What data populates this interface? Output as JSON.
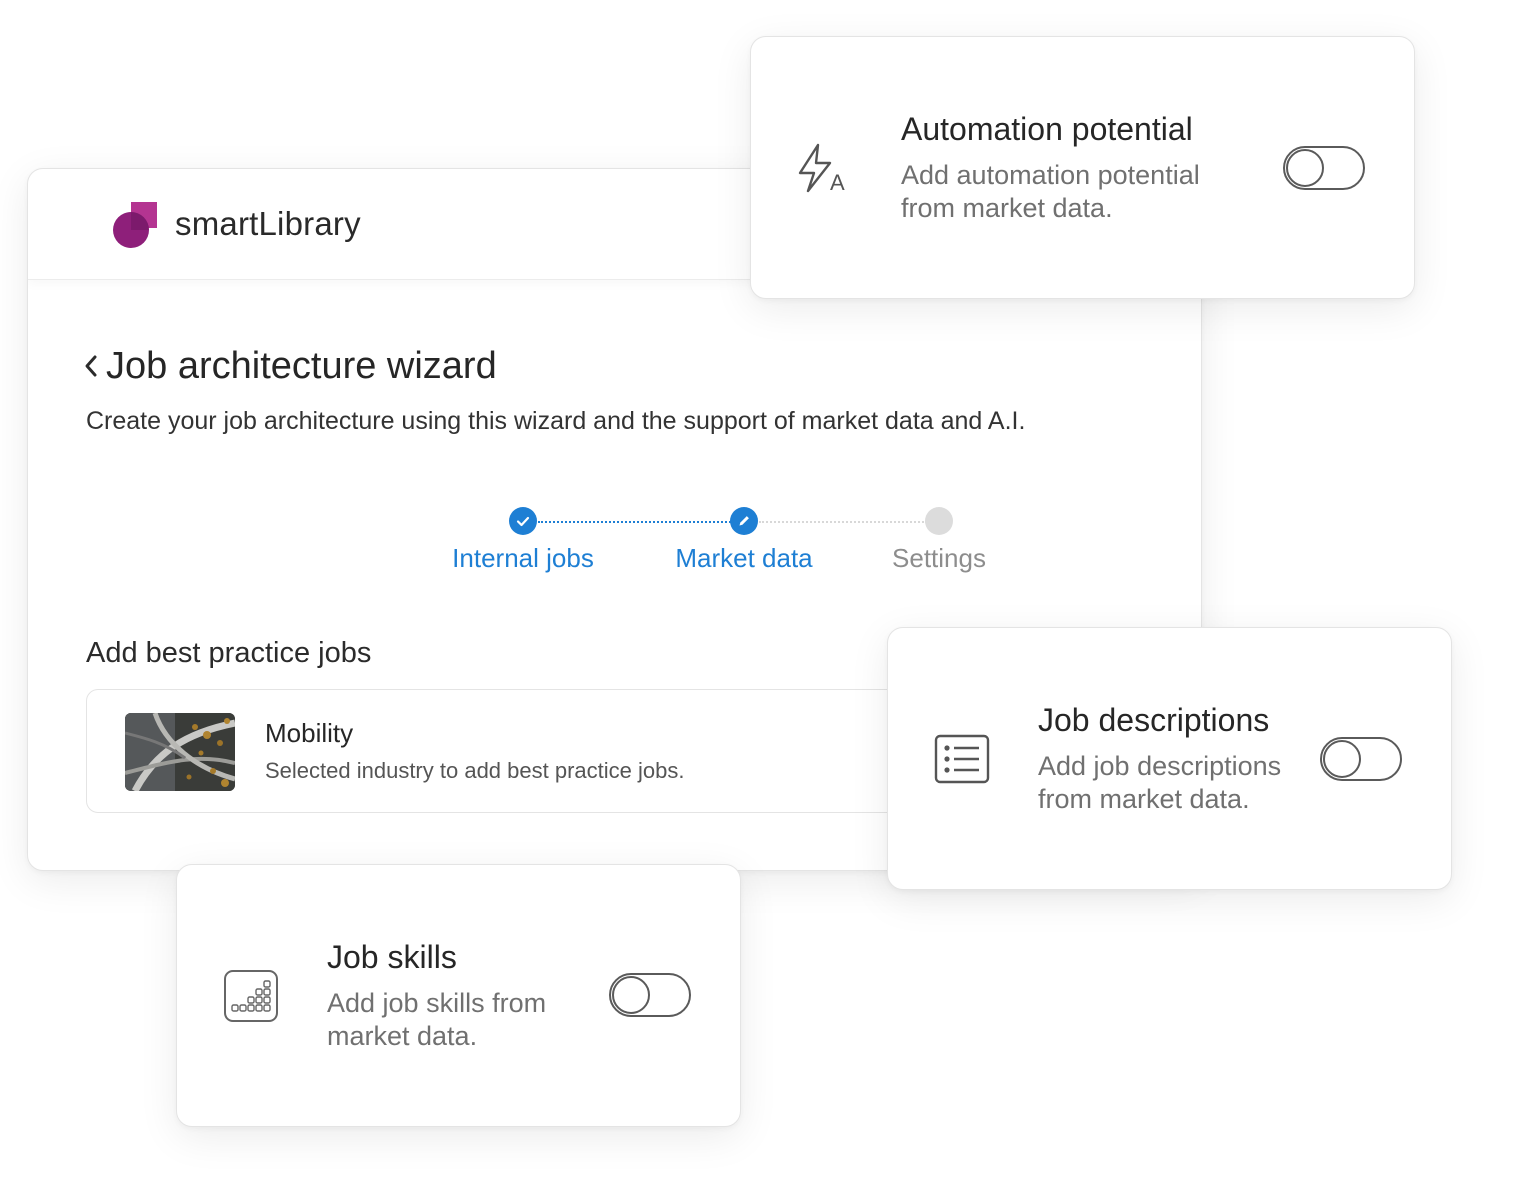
{
  "app": {
    "brand": "smartLibrary",
    "colors": {
      "accent": "#1e7fd4",
      "logo_primary": "#8e1f7a",
      "logo_secondary": "#b43491"
    }
  },
  "wizard": {
    "title": "Job architecture wizard",
    "subtitle": "Create your job architecture using this wizard and the support of market data and A.I.",
    "back_icon": "chevron-left-icon",
    "steps": [
      {
        "label": "Internal jobs",
        "state": "completed",
        "icon": "check-icon"
      },
      {
        "label": "Market data",
        "state": "current",
        "icon": "pencil-icon"
      },
      {
        "label": "Settings",
        "state": "upcoming",
        "icon": ""
      }
    ]
  },
  "best_practice": {
    "section_title": "Add best practice jobs",
    "industry": {
      "name": "Mobility",
      "description": "Selected industry to add best practice jobs.",
      "thumbnail": "highway-aerial-image"
    }
  },
  "features": [
    {
      "key": "automation",
      "title": "Automation potential",
      "description": "Add automation potential from market data.",
      "icon": "lightning-automation-icon",
      "enabled": false
    },
    {
      "key": "descriptions",
      "title": "Job descriptions",
      "description": "Add job descriptions from market data.",
      "icon": "list-document-icon",
      "enabled": false
    },
    {
      "key": "skills",
      "title": "Job skills",
      "description": "Add job skills from market data.",
      "icon": "skills-grid-icon",
      "enabled": false
    }
  ]
}
